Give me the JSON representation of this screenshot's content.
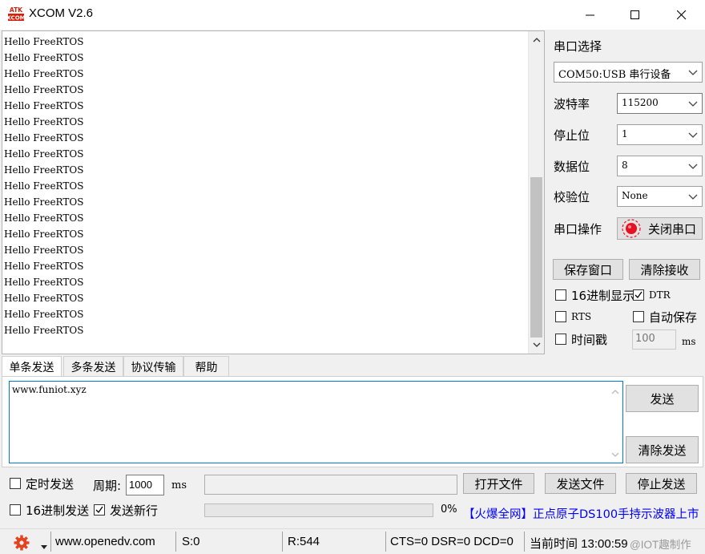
{
  "window": {
    "title": "XCOM V2.6",
    "logo_text_top": "ATK",
    "logo_text_bottom": "XCOM"
  },
  "receive": {
    "lines": [
      "Hello FreeRTOS",
      "Hello FreeRTOS",
      "Hello FreeRTOS",
      "Hello FreeRTOS",
      "Hello FreeRTOS",
      "Hello FreeRTOS",
      "Hello FreeRTOS",
      "Hello FreeRTOS",
      "Hello FreeRTOS",
      "Hello FreeRTOS",
      "Hello FreeRTOS",
      "Hello FreeRTOS",
      "Hello FreeRTOS",
      "Hello FreeRTOS",
      "Hello FreeRTOS",
      "Hello FreeRTOS",
      "Hello FreeRTOS",
      "Hello FreeRTOS",
      "Hello FreeRTOS"
    ]
  },
  "serial": {
    "port_select_label": "串口选择",
    "port_value": "COM50:USB 串行设备",
    "baud_label": "波特率",
    "baud_value": "115200",
    "stop_label": "停止位",
    "stop_value": "1",
    "data_label": "数据位",
    "data_value": "8",
    "parity_label": "校验位",
    "parity_value": "None",
    "op_label": "串口操作",
    "close_button": "关闭串口",
    "save_window_button": "保存窗口",
    "clear_recv_button": "清除接收",
    "hex_display_label": "16进制显示",
    "dtr_label": "DTR",
    "rts_label": "RTS",
    "auto_save_label": "自动保存",
    "timestamp_label": "时间戳",
    "timestamp_value": "100",
    "timestamp_unit": "ms",
    "dtr_checked": true,
    "hex_display_checked": false,
    "rts_checked": false,
    "auto_save_checked": false,
    "timestamp_checked": false
  },
  "tabs": [
    "单条发送",
    "多条发送",
    "协议传输",
    "帮助"
  ],
  "send": {
    "text": "www.funiot.xyz",
    "send_button": "发送",
    "clear_send_button": "清除发送",
    "timed_send_label": "定时发送",
    "period_label": "周期:",
    "period_value": "1000",
    "period_unit": "ms",
    "open_file_button": "打开文件",
    "send_file_button": "发送文件",
    "stop_send_button": "停止发送",
    "hex_send_label": "16进制发送",
    "newline_label": "发送新行",
    "newline_checked": true,
    "timed_send_checked": false,
    "hex_send_checked": false,
    "progress_text": "0%",
    "progress_value": 0,
    "ad_link": "【火爆全网】正点原子DS100手持示波器上市"
  },
  "status": {
    "website": "www.openedv.com",
    "sent": "S:0",
    "received": "R:544",
    "lines": "CTS=0 DSR=0 DCD=0",
    "time": "当前时间 13:00:59",
    "watermark": "@IOT趣制作"
  },
  "colors": {
    "accent_red": "#e81123",
    "link_blue": "#0000ff",
    "focus_blue": "#0078d7"
  },
  "icons": {
    "gear": "gear-icon",
    "led": "red-led-icon"
  }
}
